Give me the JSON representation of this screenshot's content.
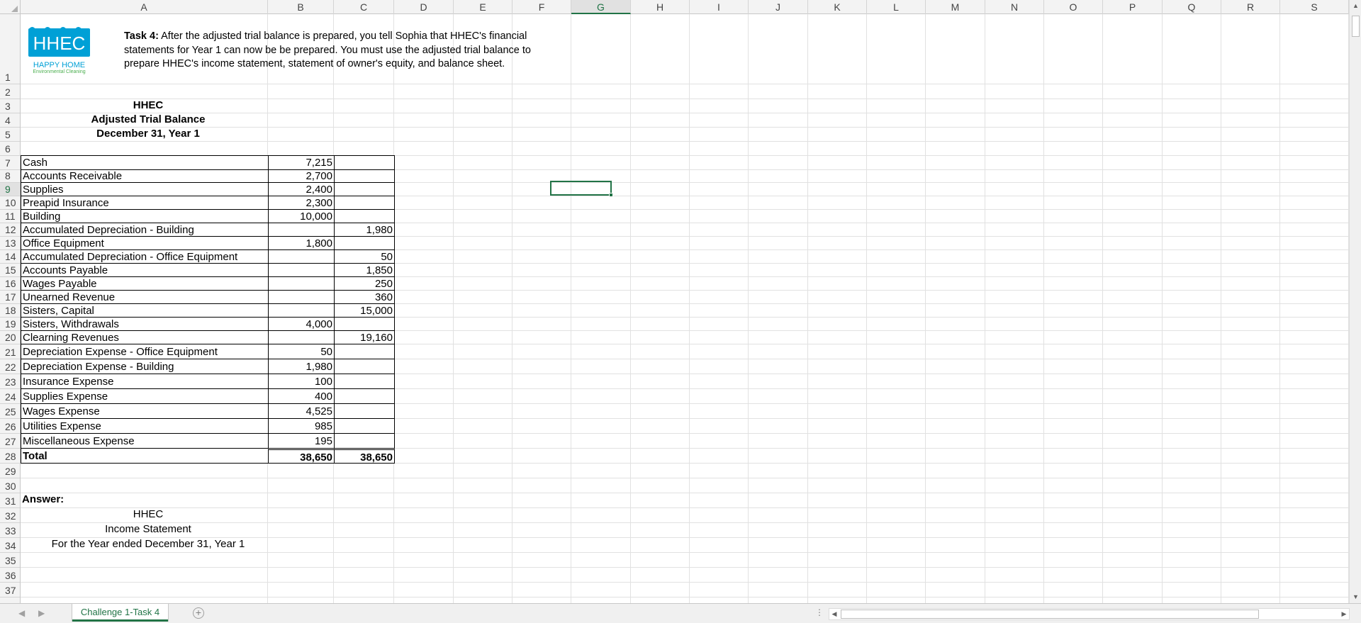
{
  "columns": [
    "A",
    "B",
    "C",
    "D",
    "E",
    "F",
    "G",
    "H",
    "I",
    "J",
    "K",
    "L",
    "M",
    "N",
    "O",
    "P",
    "Q",
    "R",
    "S"
  ],
  "selected_column": "G",
  "rows": [
    "1",
    "2",
    "3",
    "4",
    "5",
    "6",
    "7",
    "8",
    "9",
    "10",
    "11",
    "12",
    "13",
    "14",
    "15",
    "16",
    "17",
    "18",
    "19",
    "20",
    "21",
    "22",
    "23",
    "24",
    "25",
    "26",
    "27",
    "28",
    "29",
    "30",
    "31",
    "32",
    "33",
    "34",
    "35",
    "36",
    "37"
  ],
  "selected_row": "9",
  "logo": {
    "title": "HHEC",
    "line1": "HAPPY HOME",
    "line2": "Environmental Cleaning"
  },
  "task": {
    "label": "Task 4:",
    "text": " After the adjusted trial balance is prepared, you tell Sophia that HHEC's financial statements for Year 1 can now be be prepared. You must use the adjusted trial balance to prepare HHEC's income statement, statement of owner's equity, and balance sheet."
  },
  "heading": {
    "company": "HHEC",
    "title": "Adjusted Trial Balance",
    "date": "December 31, Year 1"
  },
  "trial_balance": [
    {
      "account": "Cash",
      "debit": "7,215",
      "credit": ""
    },
    {
      "account": "Accounts Receivable",
      "debit": "2,700",
      "credit": ""
    },
    {
      "account": "Supplies",
      "debit": "2,400",
      "credit": ""
    },
    {
      "account": "Preapid Insurance",
      "debit": "2,300",
      "credit": ""
    },
    {
      "account": "Building",
      "debit": "10,000",
      "credit": ""
    },
    {
      "account": "Accumulated Depreciation - Building",
      "debit": "",
      "credit": "1,980"
    },
    {
      "account": "Office Equipment",
      "debit": "1,800",
      "credit": ""
    },
    {
      "account": "Accumulated Depreciation - Office Equipment",
      "debit": "",
      "credit": "50"
    },
    {
      "account": "Accounts Payable",
      "debit": "",
      "credit": "1,850"
    },
    {
      "account": "Wages Payable",
      "debit": "",
      "credit": "250"
    },
    {
      "account": "Unearned Revenue",
      "debit": "",
      "credit": "360"
    },
    {
      "account": "Sisters, Capital",
      "debit": "",
      "credit": "15,000"
    },
    {
      "account": "Sisters,  Withdrawals",
      "debit": "4,000",
      "credit": ""
    },
    {
      "account": "Clearning Revenues",
      "debit": "",
      "credit": "19,160"
    },
    {
      "account": "Depreciation Expense - Office Equipment",
      "debit": "50",
      "credit": ""
    },
    {
      "account": "Depreciation Expense - Building",
      "debit": "1,980",
      "credit": ""
    },
    {
      "account": "Insurance Expense",
      "debit": "100",
      "credit": ""
    },
    {
      "account": "Supplies Expense",
      "debit": "400",
      "credit": ""
    },
    {
      "account": "Wages Expense",
      "debit": "4,525",
      "credit": ""
    },
    {
      "account": "Utilities Expense",
      "debit": "985",
      "credit": ""
    },
    {
      "account": "Miscellaneous Expense",
      "debit": "195",
      "credit": ""
    }
  ],
  "total": {
    "label": "Total",
    "debit": "38,650",
    "credit": "38,650"
  },
  "answer": {
    "label": "Answer:",
    "company": "HHEC",
    "statement": "Income Statement",
    "period": "For the Year ended December 31, Year 1"
  },
  "sheet_tab": "Challenge 1-Task 4",
  "add_sheet": "+",
  "nav": {
    "prev": "◀",
    "next": "▶",
    "more": "⋮"
  },
  "colors": {
    "accent": "#217346",
    "logo_blue": "#00a0d6",
    "logo_green": "#4caf50"
  }
}
